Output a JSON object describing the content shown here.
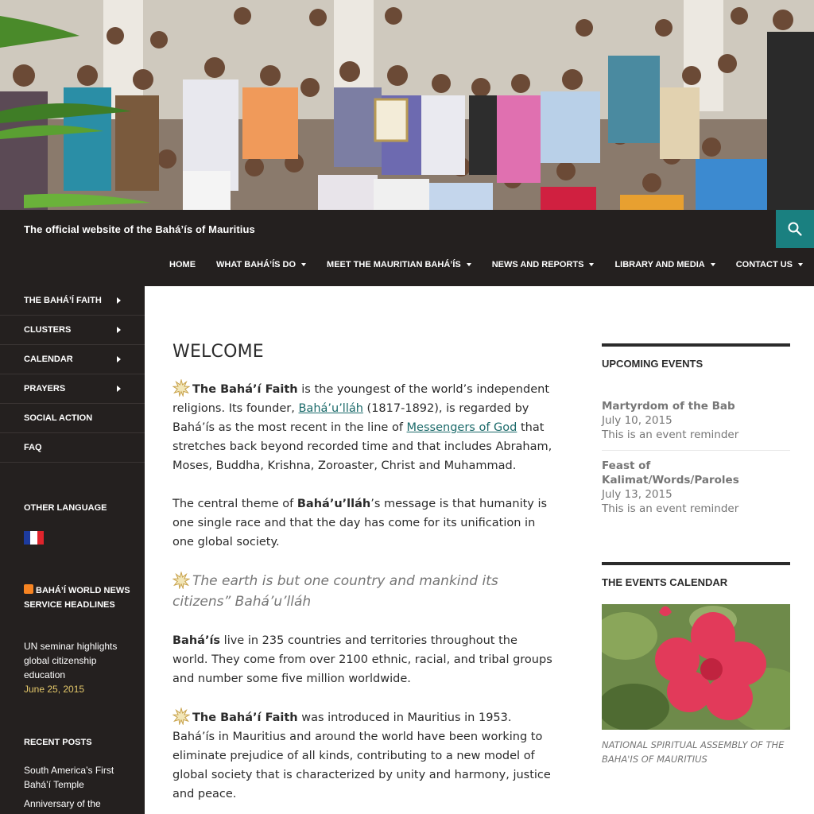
{
  "header": {
    "site_title": "The official website of the Bahá’ís of Mauritius",
    "hero_alt": "Group photo of the Bahá’ís of Mauritius"
  },
  "nav": {
    "items": [
      {
        "label": "HOME",
        "has_submenu": false
      },
      {
        "label": "WHAT BAHÁ’ÍS DO",
        "has_submenu": true
      },
      {
        "label": "MEET THE MAURITIAN BAHÁ’ÍS",
        "has_submenu": true
      },
      {
        "label": "NEWS AND REPORTS",
        "has_submenu": true
      },
      {
        "label": "LIBRARY AND MEDIA",
        "has_submenu": true
      },
      {
        "label": "CONTACT US",
        "has_submenu": true
      }
    ]
  },
  "sidebar": {
    "menu": [
      {
        "label": "THE BAHÁ’Í FAITH",
        "has_submenu": true
      },
      {
        "label": "CLUSTERS",
        "has_submenu": true
      },
      {
        "label": "CALENDAR",
        "has_submenu": true
      },
      {
        "label": "PRAYERS",
        "has_submenu": true
      },
      {
        "label": "SOCIAL ACTION",
        "has_submenu": false
      },
      {
        "label": "FAQ",
        "has_submenu": false
      }
    ],
    "other_language_title": "OTHER LANGUAGE",
    "news_widget_title": "BAHÁ’Í WORLD NEWS SERVICE HEADLINES",
    "news_item_title": "UN seminar highlights global citizenship education",
    "news_item_date": "June 25, 2015",
    "recent_posts_title": "RECENT POSTS",
    "recent_post_1": "South America’s First Bahá’í Temple",
    "recent_post_2": "Anniversary of the"
  },
  "main": {
    "title": "WELCOME",
    "p1": {
      "bold": "The Bahá’í Faith",
      "t1": " is the youngest of the world’s independent religions.  Its founder, ",
      "link1": "Bahá’u’lláh",
      "t2": " (1817-1892), is regarded by Bahá’ís as the most recent in the line of ",
      "link2": "Messengers of God",
      "t3": " that stretches back beyond recorded time and that includes Abraham, Moses, Buddha, Krishna, Zoroaster, Christ and Muhammad."
    },
    "p2": {
      "t1": "The central theme of ",
      "bold": "Bahá’u’lláh",
      "t2": "’s message is that humanity is one single race and that the day has come for its unification in one global society."
    },
    "quote": "The earth is but one country and mankind its citizens” Bahá’u’lláh",
    "p3": {
      "bold": "Bahá’ís",
      "t1": " live in 235 countries and territories throughout the world. They come from over 2100 ethnic, racial, and tribal groups and number some five million worldwide."
    },
    "p4": {
      "bold": "The Bahá’í Faith",
      "t1": " was introduced in Mauritius in 1953. Bahá’ís in Mauritius and around the world have been working to eliminate prejudice of all kinds, contributing to a new model of global society that is characterized by unity and harmony, justice and peace."
    }
  },
  "right_sidebar": {
    "upcoming_title": "UPCOMING EVENTS",
    "events": [
      {
        "title": "Martyrdom of the Bab",
        "date": "July 10, 2015",
        "desc": "This is an event reminder"
      },
      {
        "title": "Feast of Kalimat/Words/Paroles",
        "date": "July 13, 2015",
        "desc": "This is an event reminder"
      }
    ],
    "calendar_title": "THE EVENTS CALENDAR",
    "image_caption": "NATIONAL SPIRITUAL ASSEMBLY OF THE BAHA'IS OF MAURITIUS"
  },
  "colors": {
    "header_bg": "#24201f",
    "search_bg": "#1a8080",
    "link": "#1b6a6a",
    "date_gold": "#e4c86a",
    "flag_blue": "#1d3b9e",
    "flag_white": "#ffffff",
    "flag_red": "#e0242c"
  },
  "icons": {
    "search": "search-icon",
    "star": "nine-pointed-star-icon",
    "rss": "rss-icon",
    "flag": "french-flag-icon"
  }
}
